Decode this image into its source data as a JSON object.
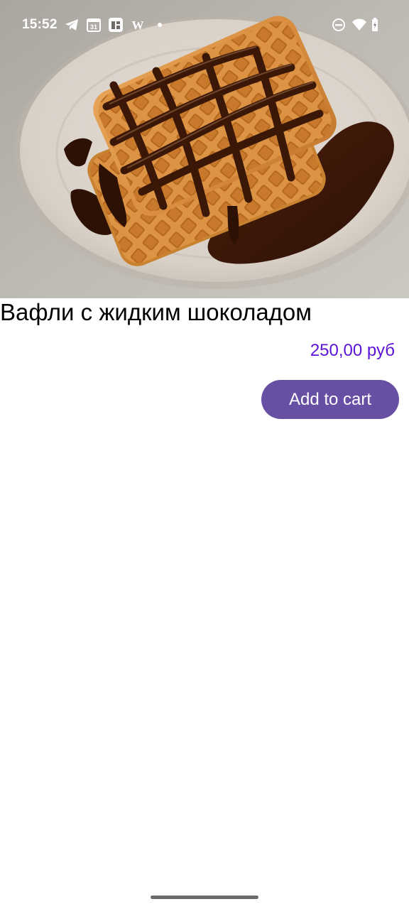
{
  "status_bar": {
    "time": "15:52",
    "left_icons": [
      "telegram-icon",
      "calendar-icon",
      "news-app-icon",
      "wikipedia-icon",
      "notification-dot-icon"
    ],
    "calendar_day": "31",
    "wiki_letter": "W",
    "right_icons": [
      "do-not-disturb-icon",
      "wifi-icon",
      "battery-charging-icon"
    ]
  },
  "product": {
    "image_subject": "waffles with chocolate sauce",
    "title": "Вафли с жидким шоколадом",
    "price": "250,00 руб",
    "add_to_cart_label": "Add to cart"
  },
  "colors": {
    "price": "#5b13d6",
    "button": "#6750a4",
    "button_text": "#ffffff"
  }
}
